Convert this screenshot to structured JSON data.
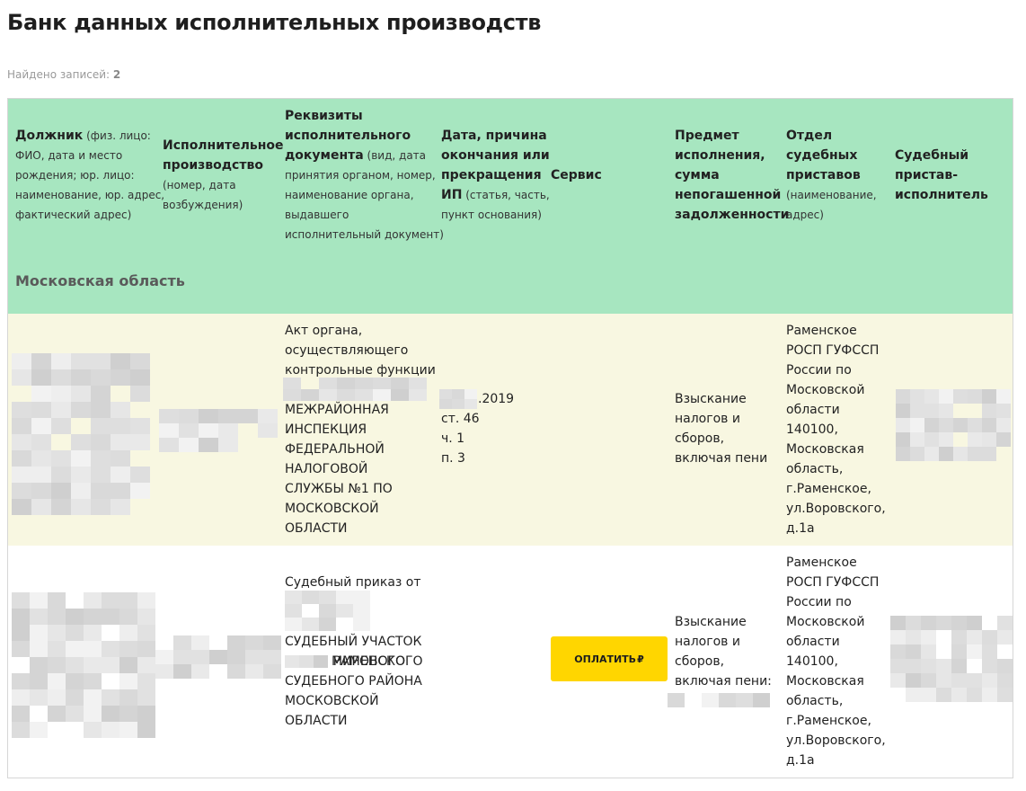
{
  "page": {
    "title": "Банк данных исполнительных производств",
    "records_label": "Найдено записей:",
    "records_count": "2"
  },
  "columns": {
    "debtor": {
      "lines": [
        [
          {
            "t": "Должник",
            "b": true
          },
          {
            "t": " (физ. лицо:",
            "b": false
          }
        ],
        [
          {
            "t": "ФИО, дата и место",
            "b": false
          }
        ],
        [
          {
            "t": "рождения; юр. лицо:",
            "b": false
          }
        ],
        [
          {
            "t": "наименование, юр. адрес,",
            "b": false
          }
        ],
        [
          {
            "t": "фактический адрес)",
            "b": false
          }
        ]
      ]
    },
    "proceeding": {
      "lines": [
        [
          {
            "t": "Исполнительное",
            "b": true
          }
        ],
        [
          {
            "t": "производство",
            "b": true
          }
        ],
        [
          {
            "t": "(номер, дата",
            "b": false
          }
        ],
        [
          {
            "t": "возбуждения)",
            "b": false
          }
        ]
      ]
    },
    "document": {
      "lines": [
        [
          {
            "t": "Реквизиты",
            "b": true
          }
        ],
        [
          {
            "t": "исполнительного",
            "b": true
          }
        ],
        [
          {
            "t": "документа",
            "b": true
          },
          {
            "t": " (вид, дата",
            "b": false
          }
        ],
        [
          {
            "t": "принятия органом, номер,",
            "b": false
          }
        ],
        [
          {
            "t": "наименование органа,",
            "b": false
          }
        ],
        [
          {
            "t": "выдавшего",
            "b": false
          }
        ],
        [
          {
            "t": "исполнительный документ)",
            "b": false
          }
        ]
      ]
    },
    "end_date": {
      "lines": [
        [
          {
            "t": "Дата, причина",
            "b": true
          }
        ],
        [
          {
            "t": "окончания или",
            "b": true
          }
        ],
        [
          {
            "t": "прекращения",
            "b": true
          }
        ],
        [
          {
            "t": "ИП",
            "b": true
          },
          {
            "t": " (статья, часть,",
            "b": false
          }
        ],
        [
          {
            "t": "пункт основания)",
            "b": false
          }
        ]
      ]
    },
    "service": {
      "lines": [
        [
          {
            "t": "Сервис",
            "b": true
          }
        ]
      ]
    },
    "subject": {
      "lines": [
        [
          {
            "t": "Предмет",
            "b": true
          }
        ],
        [
          {
            "t": "исполнения,",
            "b": true
          }
        ],
        [
          {
            "t": "сумма",
            "b": true
          }
        ],
        [
          {
            "t": "непогашенной",
            "b": true
          }
        ],
        [
          {
            "t": "задолженности",
            "b": true
          }
        ]
      ]
    },
    "department": {
      "lines": [
        [
          {
            "t": "Отдел",
            "b": true
          }
        ],
        [
          {
            "t": "судебных",
            "b": true
          }
        ],
        [
          {
            "t": "приставов",
            "b": true
          }
        ],
        [
          {
            "t": "(наименование,",
            "b": false
          }
        ],
        [
          {
            "t": "адрес)",
            "b": false
          }
        ]
      ]
    },
    "bailiff": {
      "lines": [
        [
          {
            "t": "Судебный",
            "b": true
          }
        ],
        [
          {
            "t": "пристав-",
            "b": true
          }
        ],
        [
          {
            "t": "исполнитель",
            "b": true
          }
        ]
      ]
    }
  },
  "region": "Московская область",
  "rows": [
    {
      "document_intro": [
        "Акт органа,",
        "осуществляющего",
        "контрольные функции"
      ],
      "document_body": [
        "МЕЖРАЙОННАЯ",
        "ИНСПЕКЦИЯ",
        "ФЕДЕРАЛЬНОЙ",
        "НАЛОГОВОЙ",
        "СЛУЖБЫ №1 ПО",
        "МОСКОВСКОЙ",
        "ОБЛАСТИ"
      ],
      "end_date_suffix": ".2019",
      "end_reason": [
        "ст. 46",
        "ч. 1",
        "п. 3"
      ],
      "subject": [
        "Взыскание",
        "налогов и",
        "сборов,",
        "включая пени"
      ],
      "department": [
        "Раменское",
        "РОСП ГУФССП",
        "России по",
        "Московской",
        "области",
        "140100,",
        "Московская",
        "область,",
        "г.Раменское,",
        "ул.Воровского,",
        "д.1а"
      ]
    },
    {
      "document_intro": [
        "Судебный приказ от"
      ],
      "document_body_first_visible": "МИРОВОГО",
      "document_body": [
        "СУДЕБНЫЙ УЧАСТОК",
        "СУДЬИ РАМЕНСКОГО",
        "СУДЕБНОГО РАЙОНА",
        "МОСКОВСКОЙ",
        "ОБЛАСТИ"
      ],
      "service_button": "ОПЛАТИТЬ",
      "currency_symbol": "₽",
      "subject": [
        "Взыскание",
        "налогов и",
        "сборов,",
        "включая пени:"
      ],
      "department": [
        "Раменское",
        "РОСП ГУФССП",
        "России по",
        "Московской",
        "области",
        "140100,",
        "Московская",
        "область,",
        "г.Раменское,",
        "ул.Воровского,",
        "д.1а"
      ]
    }
  ],
  "colors": {
    "header_bg": "#a7e6c0",
    "row_odd_bg": "#f8f7e1",
    "row_even_bg": "#ffffff",
    "pay_button_bg": "#ffd600"
  },
  "icons": {
    "currency": "ruble-sign-icon",
    "redacted": "pixelated-redaction"
  }
}
